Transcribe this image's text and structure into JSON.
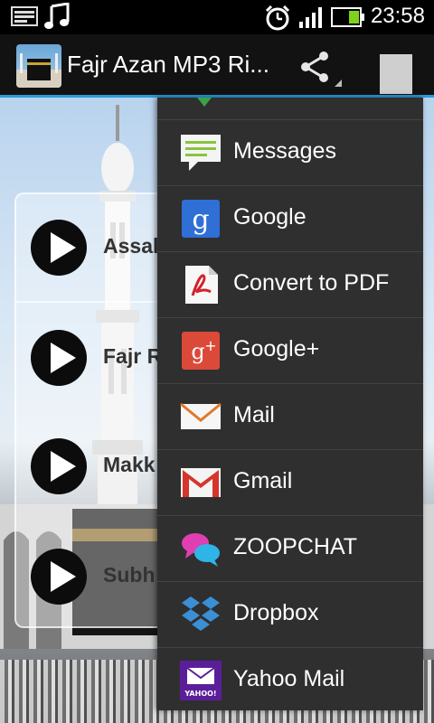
{
  "status_bar": {
    "time": "23:58",
    "icons": [
      "screenshot-icon",
      "music-note-icon",
      "alarm-clock-icon",
      "signal-icon",
      "battery-icon"
    ]
  },
  "action_bar": {
    "title": "Fajr Azan MP3 Ri...",
    "icons": [
      "app-icon",
      "share-icon",
      "overflow-menu-icon"
    ],
    "accent_color": "#2a9bd8"
  },
  "tracks": [
    {
      "title": "Assal"
    },
    {
      "title": "Fajr R"
    },
    {
      "title": "Makk"
    },
    {
      "title": "Subh"
    }
  ],
  "share_menu": {
    "items": [
      {
        "label": "Messages",
        "icon": "messages-icon"
      },
      {
        "label": "Google",
        "icon": "google-icon"
      },
      {
        "label": "Convert to PDF",
        "icon": "pdf-icon"
      },
      {
        "label": "Google+",
        "icon": "google-plus-icon"
      },
      {
        "label": "Mail",
        "icon": "mail-icon"
      },
      {
        "label": "Gmail",
        "icon": "gmail-icon"
      },
      {
        "label": "ZOOPCHAT",
        "icon": "zoopchat-icon"
      },
      {
        "label": "Dropbox",
        "icon": "dropbox-icon"
      },
      {
        "label": "Yahoo Mail",
        "icon": "yahoo-mail-icon",
        "icon_text": "YAHOO!"
      }
    ]
  }
}
